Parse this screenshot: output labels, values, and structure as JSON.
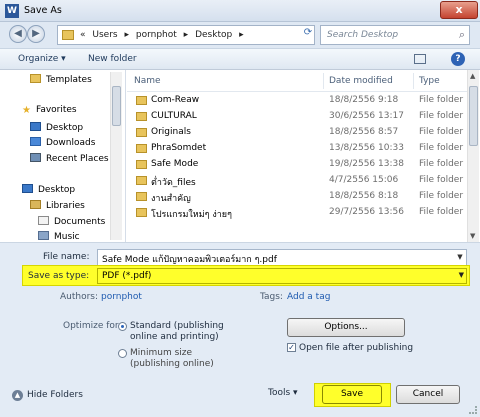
{
  "window": {
    "title": "Save As",
    "app_icon_letter": "W",
    "close_label": "x"
  },
  "address": {
    "prefix": "«",
    "crumbs": [
      "Users",
      "pornphot",
      "Desktop"
    ],
    "separator": "▸"
  },
  "search": {
    "placeholder": "Search Desktop"
  },
  "toolbar": {
    "organize_label": "Organize ▾",
    "new_folder_label": "New folder"
  },
  "nav": {
    "items": [
      {
        "label": "Templates",
        "icon": "folder-icon"
      },
      {
        "label": "Favorites",
        "icon": "star-icon"
      },
      {
        "label": "Desktop",
        "icon": "desktop-icon"
      },
      {
        "label": "Downloads",
        "icon": "downloads-icon"
      },
      {
        "label": "Recent Places",
        "icon": "recent-places-icon"
      },
      {
        "label": "Desktop",
        "icon": "desktop-icon"
      },
      {
        "label": "Libraries",
        "icon": "libraries-icon"
      },
      {
        "label": "Documents",
        "icon": "documents-icon"
      },
      {
        "label": "Music",
        "icon": "music-icon"
      }
    ]
  },
  "filelist": {
    "columns": {
      "name": "Name",
      "date": "Date modified",
      "type": "Type"
    },
    "rows": [
      {
        "name": "Com-Reaw",
        "date": "18/8/2556 9:18",
        "type": "File folder"
      },
      {
        "name": "CULTURAL",
        "date": "30/6/2556 13:17",
        "type": "File folder"
      },
      {
        "name": "Originals",
        "date": "18/8/2556 8:57",
        "type": "File folder"
      },
      {
        "name": "PhraSomdet",
        "date": "13/8/2556 10:33",
        "type": "File folder"
      },
      {
        "name": "Safe Mode",
        "date": "19/8/2556 13:38",
        "type": "File folder"
      },
      {
        "name": "ต่ำวัด_files",
        "date": "4/7/2556 15:06",
        "type": "File folder"
      },
      {
        "name": "งานสำคัญ",
        "date": "18/8/2556 8:18",
        "type": "File folder"
      },
      {
        "name": "โปรแกรมใหม่ๆ ง่ายๆ",
        "date": "29/7/2556 13:56",
        "type": "File folder"
      }
    ]
  },
  "form": {
    "file_name_label": "File name:",
    "file_name_value": "Safe Mode  แก้ปัญหาคอมพิวเตอร์มาก ๆ.pdf",
    "save_as_type_label": "Save as type:",
    "save_as_type_value": "PDF (*.pdf)",
    "authors_label": "Authors:",
    "authors_value": "pornphot",
    "tags_label": "Tags:",
    "tags_value": "Add a tag",
    "optimize_label": "Optimize for:",
    "opt_standard": "Standard (publishing online and printing)",
    "opt_minimum": "Minimum size (publishing online)",
    "options_button": "Options...",
    "open_after_label": "Open file after publishing",
    "open_after_checked": true,
    "hide_folders_label": "Hide Folders",
    "tools_label": "Tools",
    "save_button": "Save",
    "cancel_button": "Cancel"
  },
  "colors": {
    "highlight": "#ffff2b",
    "link": "#1f5bb0"
  }
}
